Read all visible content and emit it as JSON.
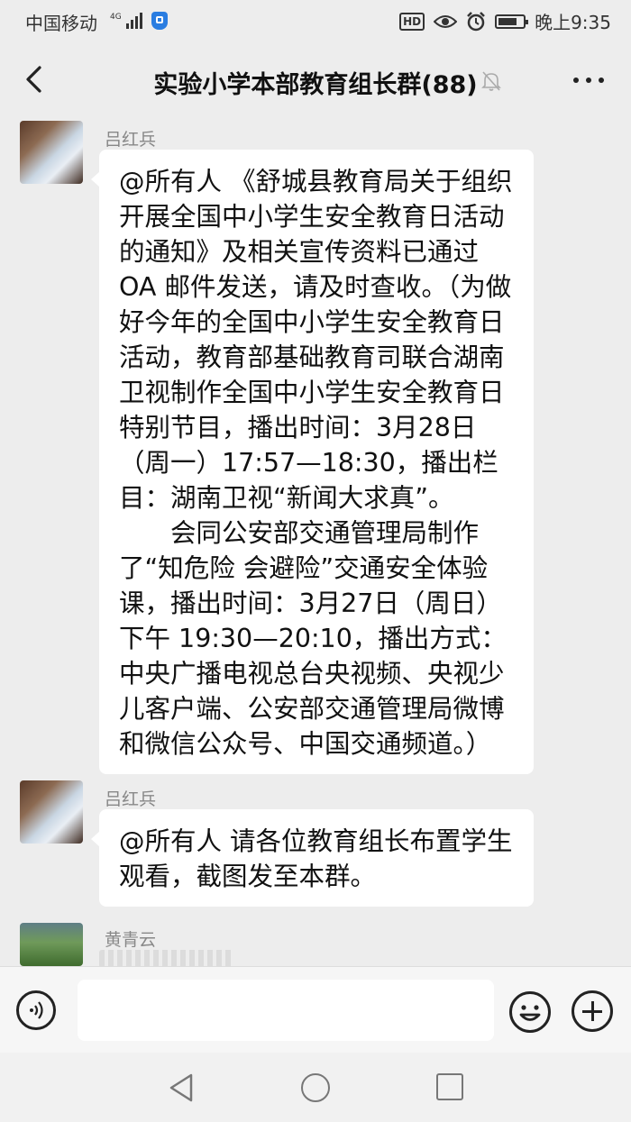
{
  "status_bar": {
    "carrier": "中国移动",
    "network": "4G",
    "time": "晚上9:35",
    "icons": [
      "signal-icon",
      "shield-icon",
      "hd-icon",
      "eye-icon",
      "alarm-icon",
      "battery-icon"
    ]
  },
  "header": {
    "title": "实验小学本部教育组长群(88)",
    "icons": [
      "back-arrow-icon",
      "mute-bell-icon",
      "more-dots-icon"
    ]
  },
  "messages": [
    {
      "sender": "吕红兵",
      "paragraphs": [
        "@所有人 《舒城县教育局关于组织开展全国中小学生安全教育日活动的通知》及相关宣传资料已通过 OA 邮件发送，请及时查收。（为做好今年的全国中小学生安全教育日活动，教育部基础教育司联合湖南卫视制作全国中小学生安全教育日特别节目，播出时间：3月28日（周一）17:57—18:30，播出栏目：湖南卫视“新闻大求真”。",
        "会同公安部交通管理局制作了“知危险 会避险”交通安全体验课，播出时间：3月27日（周日）下午 19:30—20:10，播出方式：中央广播电视总台央视频、央视少儿客户端、公安部交通管理局微博和微信公众号、中国交通频道。）"
      ]
    },
    {
      "sender": "吕红兵",
      "paragraphs": [
        "@所有人 请各位教育组长布置学生观看，截图发至本群。"
      ]
    },
    {
      "sender": "黄青云",
      "paragraphs": []
    }
  ],
  "input_bar": {
    "placeholder": "",
    "icons": [
      "voice-icon",
      "emoji-icon",
      "plus-icon"
    ]
  },
  "nav_bar": {
    "icons": [
      "nav-back-icon",
      "nav-home-icon",
      "nav-recents-icon"
    ]
  }
}
